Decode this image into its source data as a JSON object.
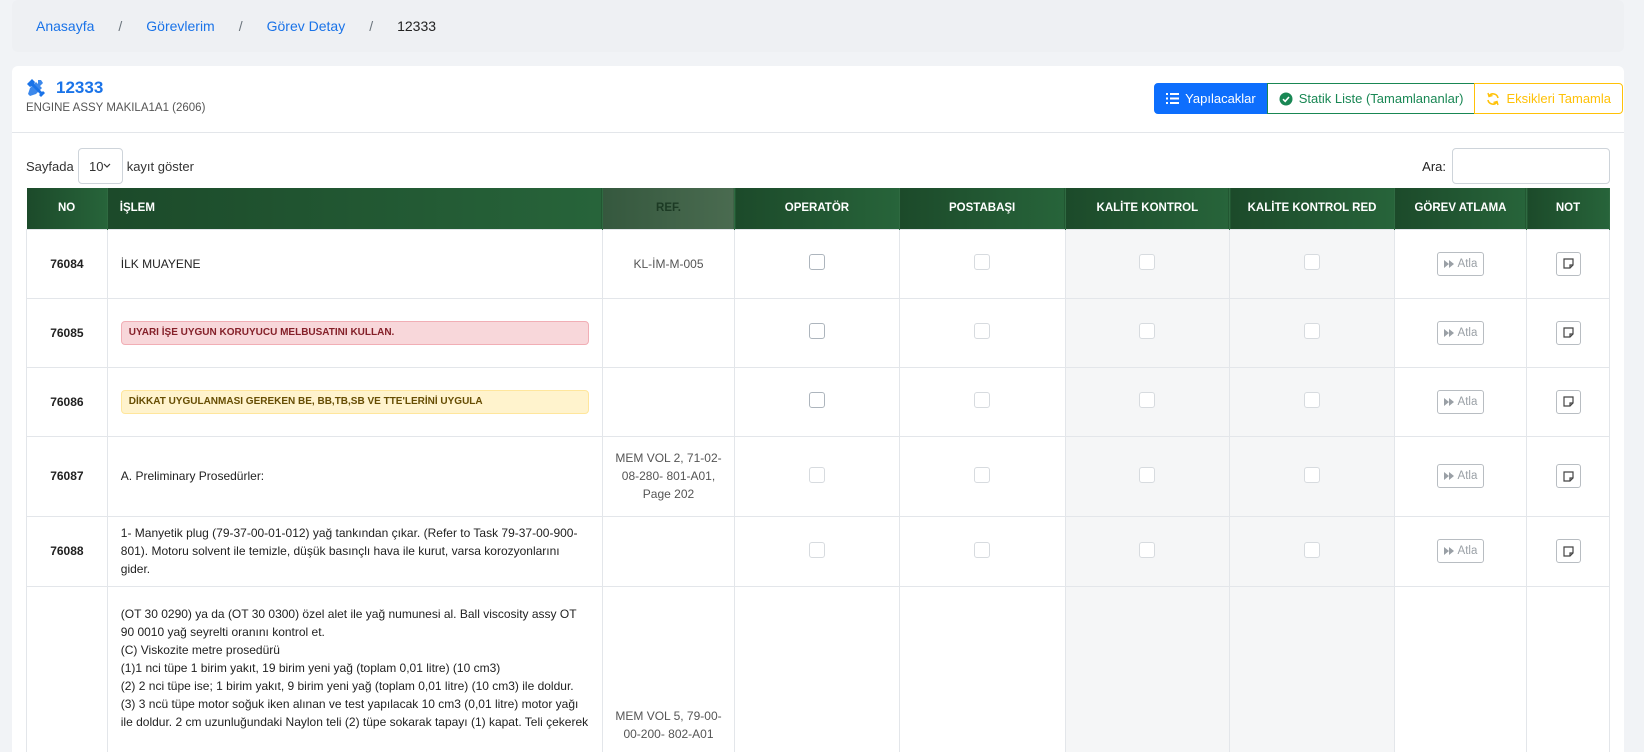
{
  "breadcrumb": {
    "items": [
      "Anasayfa",
      "Görevlerim",
      "Görev Detay"
    ],
    "separator": "/",
    "current": "12333"
  },
  "header": {
    "title": "12333",
    "subtitle": "ENGINE ASSY MAKILA1A1 (2606)",
    "buttons": {
      "todo": "Yapılacaklar",
      "static": "Statik Liste (Tamamlananlar)",
      "complete": "Eksikleri Tamamla"
    }
  },
  "controls": {
    "length_prefix": "Sayfada",
    "length_value": "10",
    "length_suffix": "kayıt göster",
    "search_label": "Ara:",
    "search_value": ""
  },
  "table": {
    "columns": [
      "NO",
      "İŞLEM",
      "REF.",
      "OPERATÖR",
      "POSTABAŞI",
      "KALİTE KONTROL",
      "KALİTE KONTROL RED",
      "GÖREV ATLAMA",
      "NOT"
    ],
    "skip_label": "Atla",
    "rows": [
      {
        "no": "76084",
        "islem": "İLK MUAYENE",
        "type": "text",
        "ref": "KL-İM-M-005"
      },
      {
        "no": "76085",
        "islem": "UYARI İŞE UYGUN KORUYUCU MELBUSATINI KULLAN.",
        "type": "danger",
        "ref": ""
      },
      {
        "no": "76086",
        "islem": "DİKKAT UYGULANMASI GEREKEN BE, BB,TB,SB VE TTE'LERİNİ UYGULA",
        "type": "warning",
        "ref": ""
      },
      {
        "no": "76087",
        "islem": "A. Preliminary Prosedürler:",
        "type": "text",
        "ref": "MEM VOL 2, 71-02-08-280- 801-A01, Page 202"
      },
      {
        "no": "76088",
        "islem": "1- Manyetik plug (79-37-00-01-012) yağ tankından çıkar. (Refer to Task 79-37-00-900-801). Motoru solvent ile temizle, düşük basınçlı hava ile kurut, varsa korozyonlarını gider.",
        "type": "text",
        "ref": ""
      },
      {
        "no": "",
        "islem": "(OT 30 0290) ya da (OT 30 0300) özel alet ile yağ numunesi al. Ball viscosity assy OT 90 0010 yağ seyrelti oranını  kontrol et.\n(C) Viskozite metre prosedürü\n(1)1 nci tüpe 1 birim yakıt, 19 birim yeni yağ (toplam 0,01 litre) (10 cm3)\n(2) 2 nci tüpe ise;  1 birim yakıt, 9 birim yeni yağ (toplam 0,01 litre) (10 cm3) ile doldur.\n(3) 3 ncü tüpe motor soğuk iken alınan ve test yapılacak 10 cm3 (0,01 litre) motor yağı ile doldur. 2 cm uzunluğundaki Naylon teli (2) tüpe sokarak tapayı (1) kapat. Teli çekerek",
        "type": "long",
        "ref": "MEM VOL 5, 79-00-00-200- 802-A01"
      }
    ]
  },
  "colors": {
    "accent": "#1a73e8",
    "header_green": "#1c4a2a",
    "success": "#198754",
    "warning": "#ffc107"
  }
}
